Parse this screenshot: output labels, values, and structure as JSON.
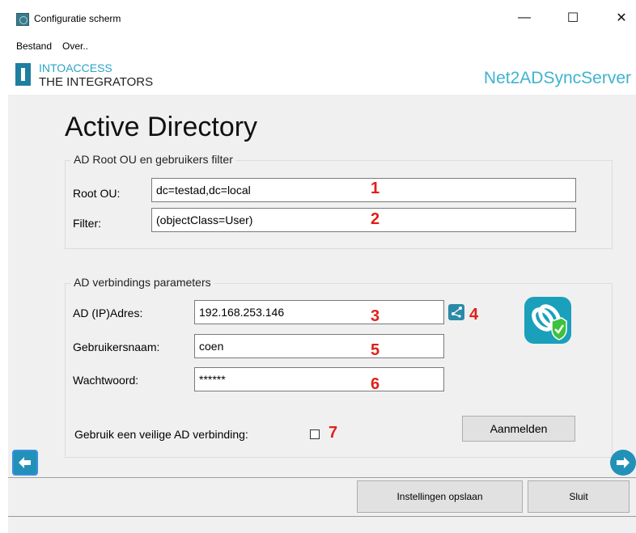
{
  "window": {
    "title": "Configuratie scherm",
    "minimize": "—",
    "maximize": "☐",
    "close": "✕"
  },
  "menu": {
    "items": [
      "Bestand",
      "Over.."
    ]
  },
  "brand": {
    "company_line1": "INTOACCESS",
    "company_line2": "THE INTEGRATORS",
    "product": "Net2ADSyncServer"
  },
  "page_title": "Active Directory",
  "root_group": {
    "title": "AD Root OU en gebruikers filter",
    "root_ou_label": "Root OU:",
    "root_ou_value": "dc=testad,dc=local",
    "filter_label": "Filter:",
    "filter_value": "(objectClass=User)"
  },
  "connection_group": {
    "title": "AD verbindings parameters",
    "address_label": "AD (IP)Adres:",
    "address_value": "192.168.253.146",
    "username_label": "Gebruikersnaam:",
    "username_value": "coen",
    "password_label": "Wachtwoord:",
    "password_value": "******",
    "secure_label": "Gebruik een veilige AD verbinding:",
    "secure_checked": false,
    "login_button": "Aanmelden"
  },
  "annotations": [
    "1",
    "2",
    "3",
    "4",
    "5",
    "6",
    "7"
  ],
  "footer": {
    "save_button": "Instellingen opslaan",
    "close_button": "Sluit"
  },
  "colors": {
    "accent": "#2aa4c7",
    "brand_dark": "#1e7fa0",
    "annotation_red": "#e0201a"
  },
  "icons": {
    "network": "network-scan-icon",
    "secure": "secure-link-shield-icon",
    "back": "arrow-left-icon",
    "forward": "arrow-right-icon"
  }
}
